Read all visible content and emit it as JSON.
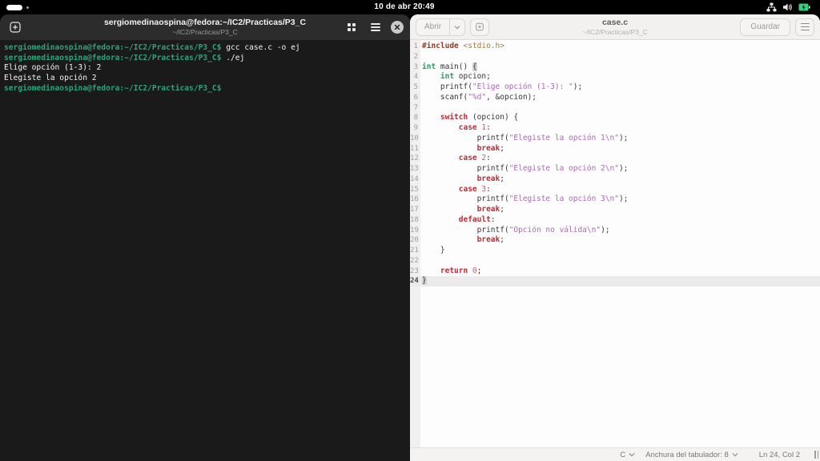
{
  "topbar": {
    "clock": "10 de abr 20:49",
    "icons": [
      "network-wired-icon",
      "volume-icon",
      "battery-icon"
    ],
    "battery_color": "#33d17a"
  },
  "terminal": {
    "title": "sergiomedinaospina@fedora:~/IC2/Practicas/P3_C",
    "subtitle": "~/IC2/Practicas/P3_C",
    "header_icons": [
      "new-tab-icon",
      "tab-overview-icon",
      "menu-icon",
      "close-icon"
    ],
    "prompt_color": "#2ba47c",
    "lines": [
      [
        {
          "c": "prompt",
          "t": "sergiomedinaospina@fedora:~/IC2/Practicas/P3_C$"
        },
        {
          "c": "cmd",
          "t": " gcc case.c -o ej"
        }
      ],
      [
        {
          "c": "prompt",
          "t": "sergiomedinaospina@fedora:~/IC2/Practicas/P3_C$"
        },
        {
          "c": "cmd",
          "t": " ./ej"
        }
      ],
      [
        {
          "c": "out",
          "t": "Elige opción (1-3): 2"
        }
      ],
      [
        {
          "c": "out",
          "t": "Elegiste la opción 2"
        }
      ],
      [
        {
          "c": "prompt",
          "t": "sergiomedinaospina@fedora:~/IC2/Practicas/P3_C$"
        }
      ]
    ]
  },
  "editor": {
    "open_label": "Abrir",
    "title": "case.c",
    "subtitle": "~/IC2/Practicas/P3_C",
    "save_label": "Guardar",
    "header_icons": [
      "open-dropdown-icon",
      "new-tab-icon",
      "menu-icon"
    ],
    "syntax_colors": {
      "preprocessor": "#99361d",
      "include_path": "#a3793b",
      "type": "#259e63",
      "keyword": "#bb2c35",
      "string": "#ad68b5",
      "number": "#cf5c68",
      "default": "#363636"
    },
    "code": {
      "current_line": 24,
      "lines": [
        [
          {
            "c": "pre",
            "t": "#include"
          },
          {
            "c": "def",
            "t": " "
          },
          {
            "c": "inc",
            "t": "<stdio.h>"
          }
        ],
        [],
        [
          {
            "c": "type",
            "t": "int"
          },
          {
            "c": "def",
            "t": " main() "
          },
          {
            "c": "brkt",
            "t": "{"
          }
        ],
        [
          {
            "c": "def",
            "t": "    "
          },
          {
            "c": "type",
            "t": "int"
          },
          {
            "c": "def",
            "t": " opcion;"
          }
        ],
        [
          {
            "c": "def",
            "t": "    printf("
          },
          {
            "c": "str",
            "t": "\"Elige opción (1-3): \""
          },
          {
            "c": "def",
            "t": ");"
          }
        ],
        [
          {
            "c": "def",
            "t": "    scanf("
          },
          {
            "c": "str",
            "t": "\"%d\""
          },
          {
            "c": "def",
            "t": ", &opcion);"
          }
        ],
        [],
        [
          {
            "c": "def",
            "t": "    "
          },
          {
            "c": "kw",
            "t": "switch"
          },
          {
            "c": "def",
            "t": " (opcion) {"
          }
        ],
        [
          {
            "c": "def",
            "t": "        "
          },
          {
            "c": "kw",
            "t": "case"
          },
          {
            "c": "def",
            "t": " "
          },
          {
            "c": "num",
            "t": "1"
          },
          {
            "c": "def",
            "t": ":"
          }
        ],
        [
          {
            "c": "def",
            "t": "            printf("
          },
          {
            "c": "str",
            "t": "\"Elegiste la opción 1\\n\""
          },
          {
            "c": "def",
            "t": ");"
          }
        ],
        [
          {
            "c": "def",
            "t": "            "
          },
          {
            "c": "kw",
            "t": "break"
          },
          {
            "c": "def",
            "t": ";"
          }
        ],
        [
          {
            "c": "def",
            "t": "        "
          },
          {
            "c": "kw",
            "t": "case"
          },
          {
            "c": "def",
            "t": " "
          },
          {
            "c": "num",
            "t": "2"
          },
          {
            "c": "def",
            "t": ":"
          }
        ],
        [
          {
            "c": "def",
            "t": "            printf("
          },
          {
            "c": "str",
            "t": "\"Elegiste la opción 2\\n\""
          },
          {
            "c": "def",
            "t": ");"
          }
        ],
        [
          {
            "c": "def",
            "t": "            "
          },
          {
            "c": "kw",
            "t": "break"
          },
          {
            "c": "def",
            "t": ";"
          }
        ],
        [
          {
            "c": "def",
            "t": "        "
          },
          {
            "c": "kw",
            "t": "case"
          },
          {
            "c": "def",
            "t": " "
          },
          {
            "c": "num",
            "t": "3"
          },
          {
            "c": "def",
            "t": ":"
          }
        ],
        [
          {
            "c": "def",
            "t": "            printf("
          },
          {
            "c": "str",
            "t": "\"Elegiste la opción 3\\n\""
          },
          {
            "c": "def",
            "t": ");"
          }
        ],
        [
          {
            "c": "def",
            "t": "            "
          },
          {
            "c": "kw",
            "t": "break"
          },
          {
            "c": "def",
            "t": ";"
          }
        ],
        [
          {
            "c": "def",
            "t": "        "
          },
          {
            "c": "kw",
            "t": "default"
          },
          {
            "c": "def",
            "t": ":"
          }
        ],
        [
          {
            "c": "def",
            "t": "            printf("
          },
          {
            "c": "str",
            "t": "\"Opción no válida\\n\""
          },
          {
            "c": "def",
            "t": ");"
          }
        ],
        [
          {
            "c": "def",
            "t": "            "
          },
          {
            "c": "kw",
            "t": "break"
          },
          {
            "c": "def",
            "t": ";"
          }
        ],
        [
          {
            "c": "def",
            "t": "    }"
          }
        ],
        [],
        [
          {
            "c": "def",
            "t": "    "
          },
          {
            "c": "kw",
            "t": "return"
          },
          {
            "c": "def",
            "t": " "
          },
          {
            "c": "num",
            "t": "0"
          },
          {
            "c": "def",
            "t": ";"
          }
        ],
        [
          {
            "c": "brkt",
            "t": "}"
          }
        ]
      ]
    },
    "statusbar": {
      "language": "C",
      "tab_width": "Anchura del tabulador: 8",
      "position": "Ln 24, Col 2"
    }
  }
}
